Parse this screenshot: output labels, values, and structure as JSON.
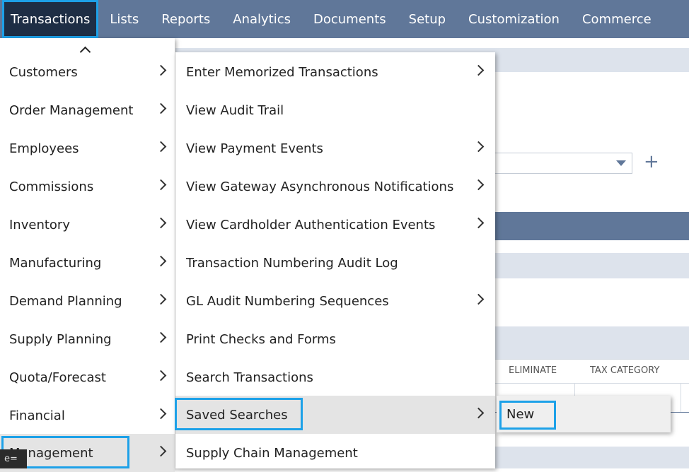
{
  "topnav": {
    "items": [
      "Transactions",
      "Lists",
      "Reports",
      "Analytics",
      "Documents",
      "Setup",
      "Customization",
      "Commerce"
    ]
  },
  "background": {
    "columns": [
      "ELIMINATE",
      "TAX CATEGORY"
    ]
  },
  "menu_level1": {
    "items": [
      "Customers",
      "Order Management",
      "Employees",
      "Commissions",
      "Inventory",
      "Manufacturing",
      "Demand Planning",
      "Supply Planning",
      "Quota/Forecast",
      "Financial",
      "Management"
    ]
  },
  "menu_level2": {
    "items": [
      "Enter Memorized Transactions",
      "View Audit Trail",
      "View Payment Events",
      "View Gateway Asynchronous Notifications",
      "View Cardholder Authentication Events",
      "Transaction Numbering Audit Log",
      "GL Audit Numbering Sequences",
      "Print Checks and Forms",
      "Search Transactions",
      "Saved Searches",
      "Supply Chain Management"
    ]
  },
  "menu_level3": {
    "items": [
      "New"
    ]
  },
  "tooltip": {
    "text": "e="
  },
  "colors": {
    "nav": "#607799",
    "highlight": "#1da1e8",
    "active_nav": "#1e2e45"
  },
  "icons": [
    "chevron-up-icon",
    "chevron-right-icon",
    "dropdown-arrow-icon",
    "plus-icon"
  ]
}
